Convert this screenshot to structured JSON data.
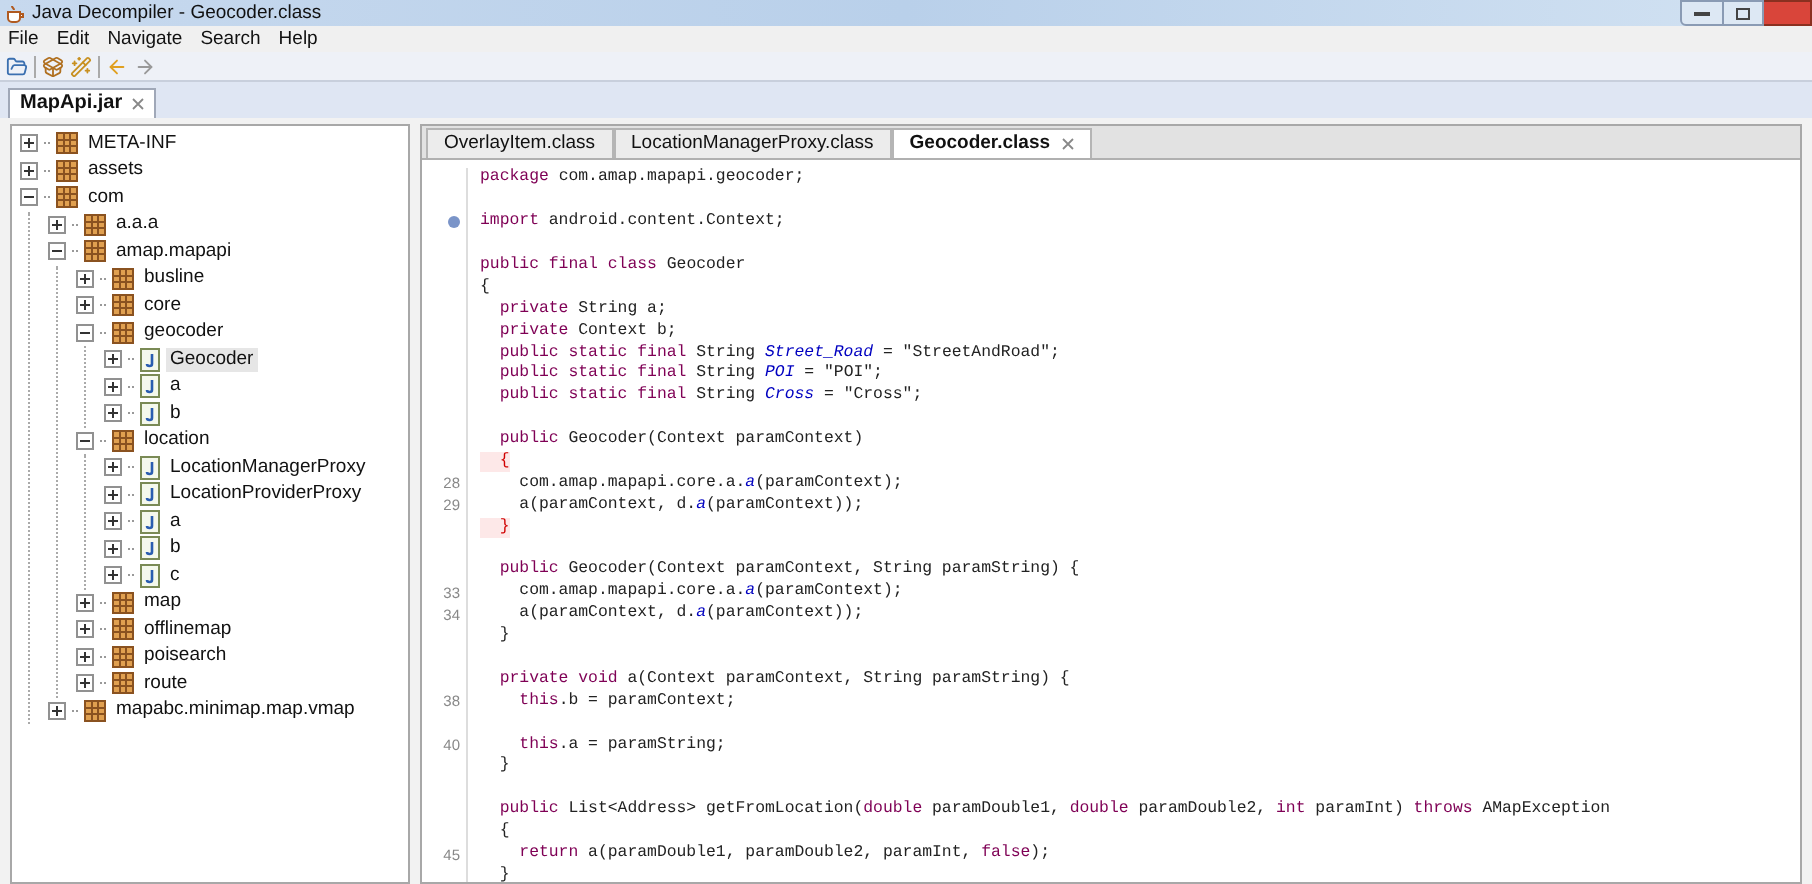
{
  "window": {
    "title": "Java Decompiler - Geocoder.class"
  },
  "menu": [
    "File",
    "Edit",
    "Navigate",
    "Search",
    "Help"
  ],
  "file_tabs": [
    {
      "label": "MapApi.jar",
      "selected": true
    }
  ],
  "tree": [
    {
      "label": "META-INF",
      "kind": "package",
      "expanded": false,
      "selected": false
    },
    {
      "label": "assets",
      "kind": "package",
      "expanded": false,
      "selected": false
    },
    {
      "label": "com",
      "kind": "package",
      "expanded": true,
      "selected": false,
      "children": [
        {
          "label": "a.a.a",
          "kind": "package",
          "expanded": false,
          "selected": false
        },
        {
          "label": "amap.mapapi",
          "kind": "package",
          "expanded": true,
          "selected": false,
          "children": [
            {
              "label": "busline",
              "kind": "package",
              "expanded": false,
              "selected": false
            },
            {
              "label": "core",
              "kind": "package",
              "expanded": false,
              "selected": false
            },
            {
              "label": "geocoder",
              "kind": "package",
              "expanded": true,
              "selected": false,
              "children": [
                {
                  "label": "Geocoder",
                  "kind": "class",
                  "expanded": false,
                  "selected": true
                },
                {
                  "label": "a",
                  "kind": "class",
                  "expanded": false,
                  "selected": false
                },
                {
                  "label": "b",
                  "kind": "class",
                  "expanded": false,
                  "selected": false
                }
              ]
            },
            {
              "label": "location",
              "kind": "package",
              "expanded": true,
              "selected": false,
              "children": [
                {
                  "label": "LocationManagerProxy",
                  "kind": "class",
                  "expanded": false,
                  "selected": false
                },
                {
                  "label": "LocationProviderProxy",
                  "kind": "class",
                  "expanded": false,
                  "selected": false
                },
                {
                  "label": "a",
                  "kind": "class",
                  "expanded": false,
                  "selected": false
                },
                {
                  "label": "b",
                  "kind": "class",
                  "expanded": false,
                  "selected": false
                },
                {
                  "label": "c",
                  "kind": "class",
                  "expanded": false,
                  "selected": false
                }
              ]
            },
            {
              "label": "map",
              "kind": "package",
              "expanded": false,
              "selected": false
            },
            {
              "label": "offlinemap",
              "kind": "package",
              "expanded": false,
              "selected": false
            },
            {
              "label": "poisearch",
              "kind": "package",
              "expanded": false,
              "selected": false
            },
            {
              "label": "route",
              "kind": "package",
              "expanded": false,
              "selected": false
            }
          ]
        },
        {
          "label": "mapabc.minimap.map.vmap",
          "kind": "package",
          "expanded": false,
          "selected": false
        }
      ]
    }
  ],
  "editor_tabs": [
    {
      "label": "OverlayItem.class",
      "selected": false
    },
    {
      "label": "LocationManagerProxy.class",
      "selected": false
    },
    {
      "label": "Geocoder.class",
      "selected": true
    }
  ],
  "code": [
    {
      "kind": "code",
      "text": "**package** com.amap.mapapi.geocoder;"
    },
    {
      "kind": "blank"
    },
    {
      "kind": "code",
      "text": "**import** android.content.Context;",
      "folded": true
    },
    {
      "kind": "blank"
    },
    {
      "kind": "code",
      "text": "**public final class** Geocoder"
    },
    {
      "kind": "code",
      "text": "{"
    },
    {
      "kind": "code",
      "text": "  **private** String a;"
    },
    {
      "kind": "code",
      "text": "  **private** Context b;"
    },
    {
      "kind": "code",
      "text": "  **public static final** String *Street_Road* = \"StreetAndRoad\";"
    },
    {
      "kind": "code",
      "text": "  **public static final** String *POI* = \"POI\";"
    },
    {
      "kind": "code",
      "text": "  **public static final** String *Cross* = \"Cross\";"
    },
    {
      "kind": "blank"
    },
    {
      "kind": "code",
      "text": "  **public** Geocoder(Context paramContext)"
    },
    {
      "kind": "code",
      "text": "  {",
      "marked": true
    },
    {
      "kind": "code",
      "number": "28",
      "text": "    com.amap.mapapi.core.a.*a*(paramContext);"
    },
    {
      "kind": "code",
      "number": "29",
      "text": "    a(paramContext, d.*a*(paramContext));"
    },
    {
      "kind": "code",
      "text": "  }",
      "marked": true
    },
    {
      "kind": "blank"
    },
    {
      "kind": "code",
      "text": "  **public** Geocoder(Context paramContext, String paramString) {"
    },
    {
      "kind": "code",
      "number": "33",
      "text": "    com.amap.mapapi.core.a.*a*(paramContext);"
    },
    {
      "kind": "code",
      "number": "34",
      "text": "    a(paramContext, d.*a*(paramContext));"
    },
    {
      "kind": "code",
      "text": "  }"
    },
    {
      "kind": "blank"
    },
    {
      "kind": "code",
      "text": "  **private void** a(Context paramContext, String paramString) {"
    },
    {
      "kind": "code",
      "number": "38",
      "text": "    **this**.b = paramContext;"
    },
    {
      "kind": "blank"
    },
    {
      "kind": "code",
      "number": "40",
      "text": "    **this**.a = paramString;"
    },
    {
      "kind": "code",
      "text": "  }"
    },
    {
      "kind": "blank"
    },
    {
      "kind": "code",
      "text": "  **public** List<Address> getFromLocation(**double** paramDouble1, **double** paramDouble2, **int** paramInt) **throws** AMapException"
    },
    {
      "kind": "code",
      "text": "  {"
    },
    {
      "kind": "code",
      "number": "45",
      "text": "    **return** a(paramDouble1, paramDouble2, paramInt, **false**);"
    },
    {
      "kind": "code",
      "text": "  }"
    }
  ]
}
